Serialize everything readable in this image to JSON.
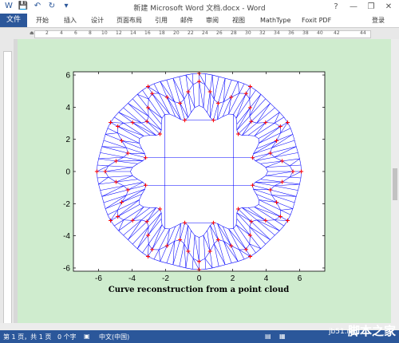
{
  "window": {
    "title": "新建 Microsoft Word 文档.docx - Word",
    "help": "?",
    "minimize": "—",
    "restore": "❐",
    "close": "✕"
  },
  "ribbon": {
    "file": "文件",
    "tabs": [
      "开始",
      "插入",
      "设计",
      "页面布局",
      "引用",
      "邮件",
      "审阅",
      "视图",
      "MathType",
      "Foxit PDF"
    ],
    "login": "登录"
  },
  "ruler": {
    "labels": [
      "2",
      "4",
      "6",
      "8",
      "10",
      "12",
      "14",
      "16",
      "18",
      "20",
      "22",
      "24",
      "26",
      "28",
      "30",
      "32",
      "34",
      "36",
      "38",
      "40",
      "42",
      "44"
    ]
  },
  "chart_data": {
    "type": "line",
    "title": "Curve reconstruction from a point cloud",
    "xlim": [
      -7.5,
      7.5
    ],
    "ylim": [
      -6.2,
      6.2
    ],
    "xticks": [
      "-6",
      "-4",
      "-2",
      "0",
      "2",
      "4",
      "6"
    ],
    "yticks": [
      "6",
      "4",
      "2",
      "0",
      "-2",
      "-4",
      "-6"
    ],
    "series": [
      {
        "color": "#0000ff",
        "style": "triangulation mesh"
      },
      {
        "color": "#ff0000",
        "style": "points (+)"
      }
    ],
    "grid": false
  },
  "status": {
    "page": "第 1 页，共 1 页",
    "words": "0 个字",
    "lang": "中文(中国)",
    "watermark_site": "jb51.net",
    "watermark_text": "脚本之家"
  },
  "colors": {
    "word_blue": "#2b579a",
    "page_bg": "#cfecce",
    "mesh": "#0000ff",
    "points": "#ff0000"
  }
}
